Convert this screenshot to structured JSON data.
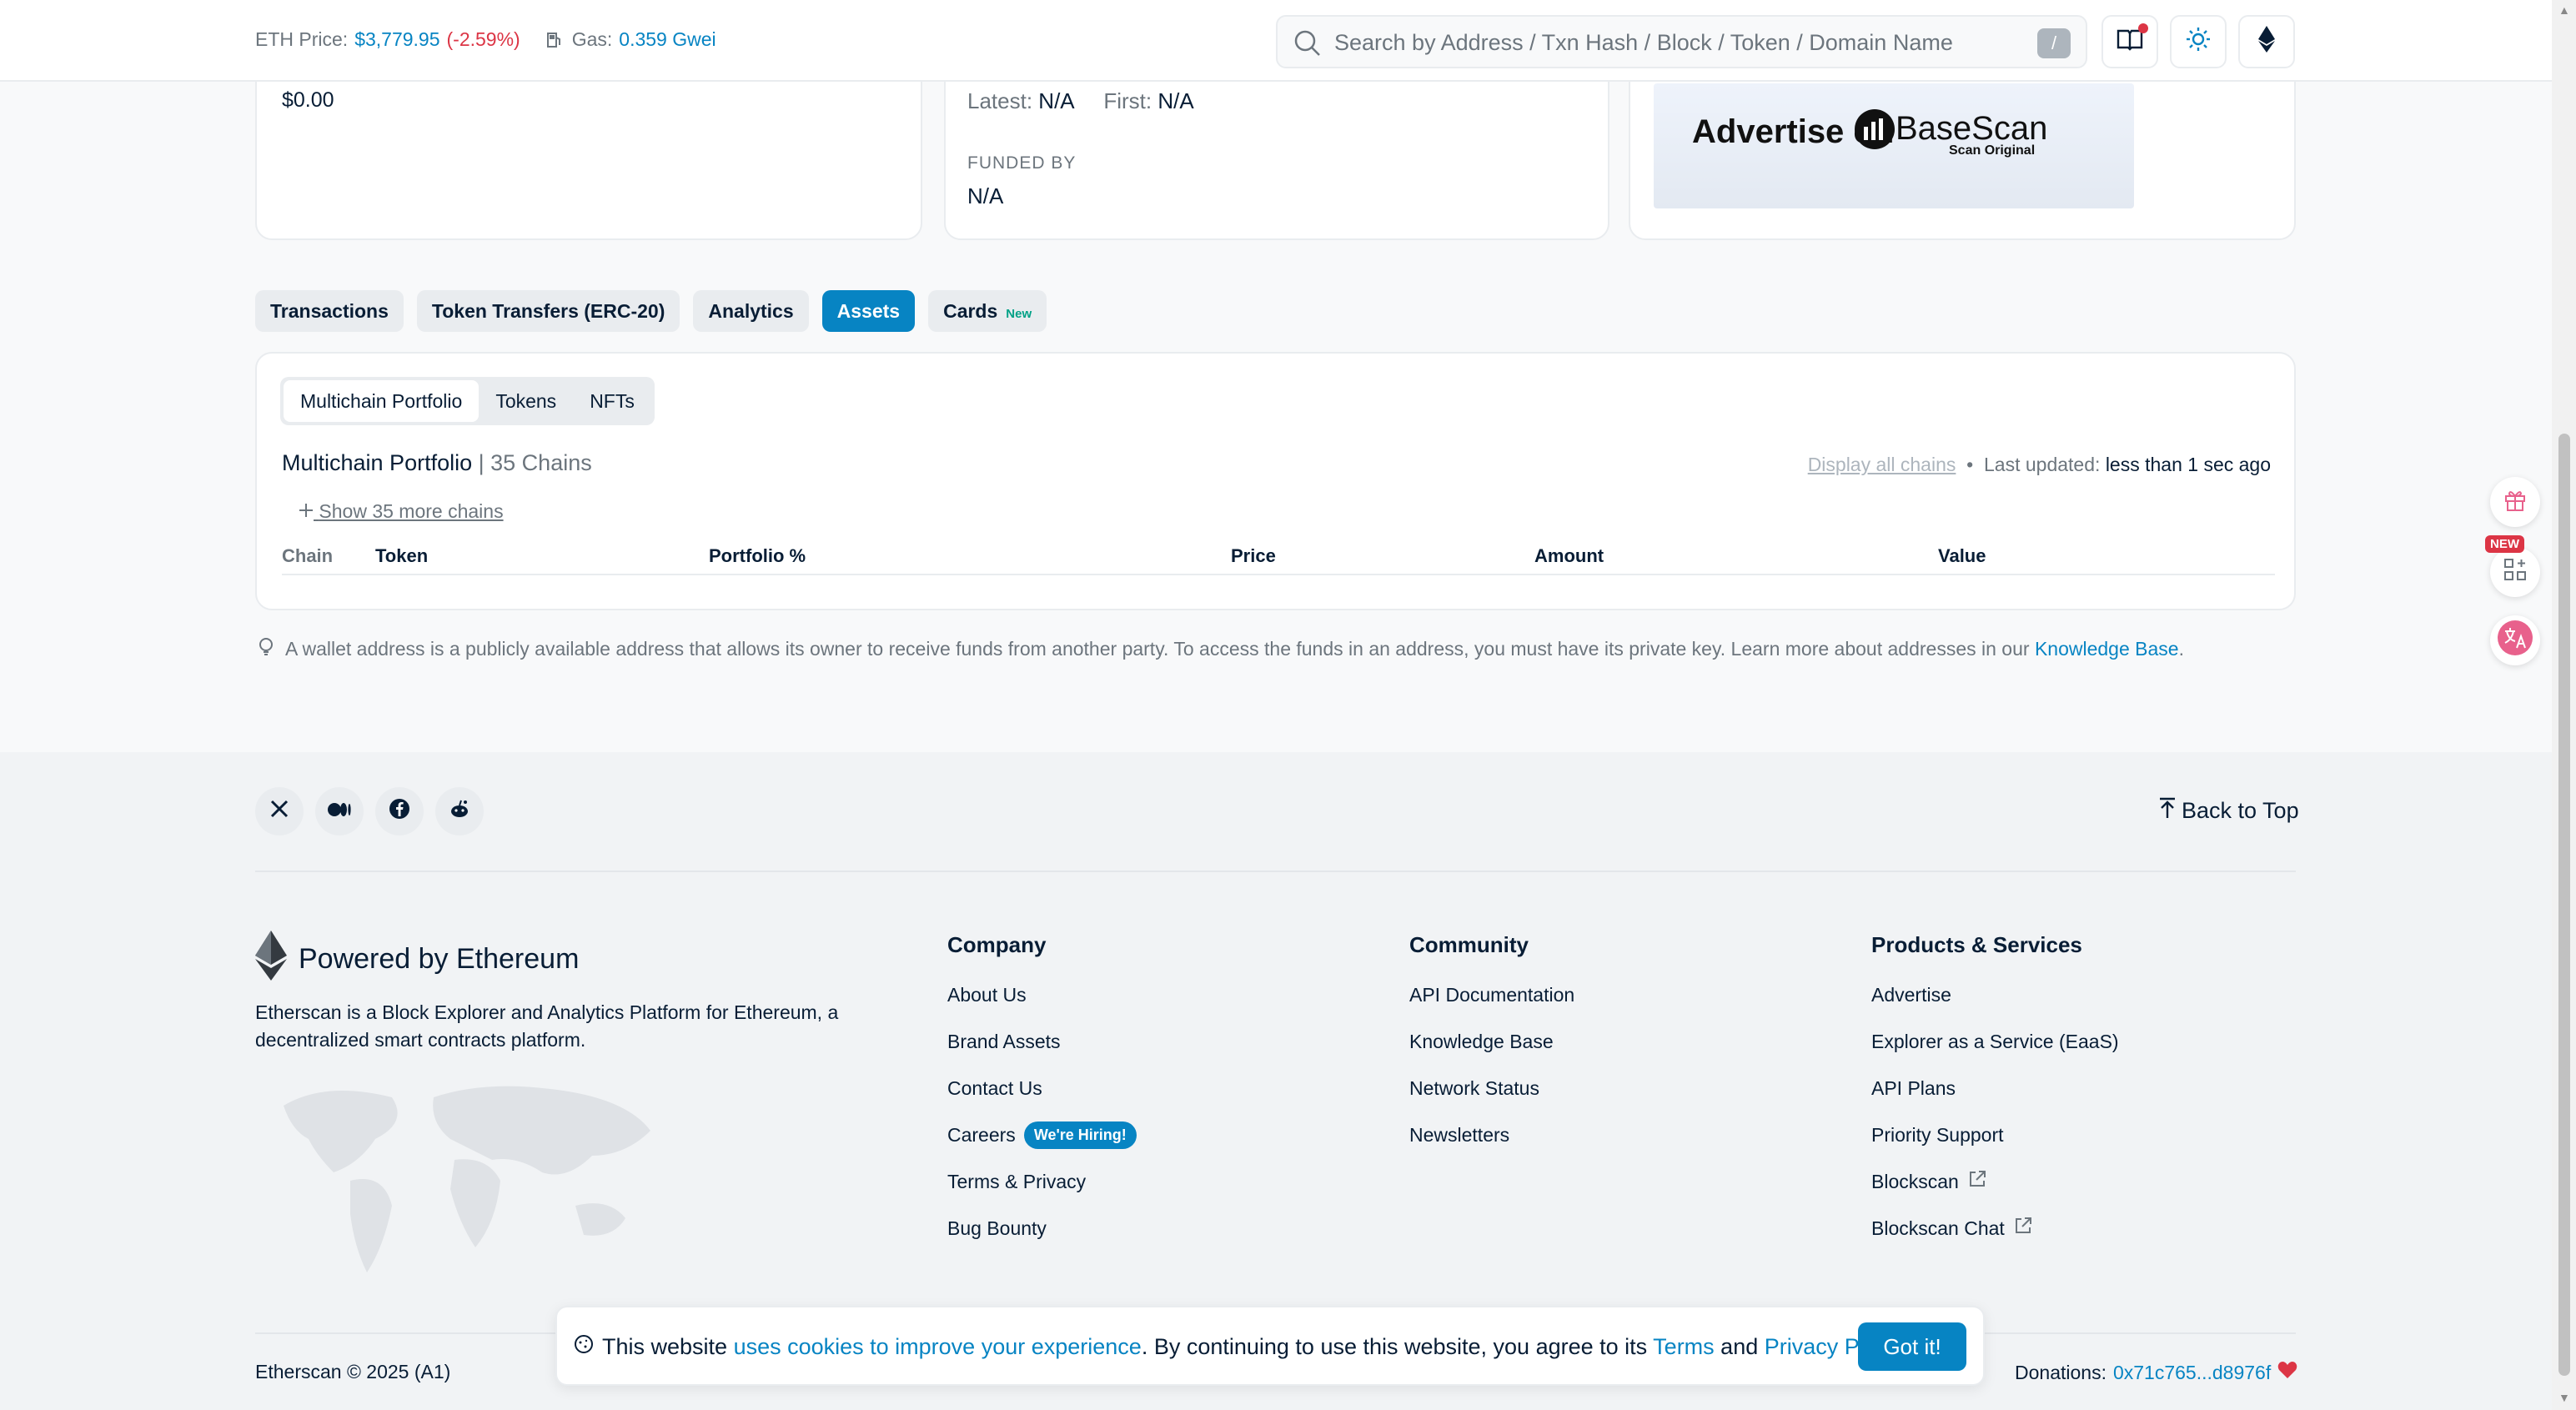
{
  "header": {
    "eth_price_label": "ETH Price:",
    "eth_price": "$3,779.95",
    "eth_change": "(-2.59%)",
    "gas_label": "Gas:",
    "gas_value": "0.359 Gwei",
    "search_placeholder": "Search by Address / Txn Hash / Block / Token / Domain Name",
    "search_shortcut": "/"
  },
  "overview": {
    "value": "$0.00",
    "latest_label": "Latest:",
    "latest_value": "N/A",
    "first_label": "First:",
    "first_value": "N/A",
    "funded_by_label": "FUNDED BY",
    "funded_by_value": "N/A",
    "ad_text": "Advertise on",
    "ad_brand": "BaseScan",
    "ad_brand_sub": "Scan Original"
  },
  "tabs": [
    {
      "label": "Transactions"
    },
    {
      "label": "Token Transfers (ERC-20)"
    },
    {
      "label": "Analytics"
    },
    {
      "label": "Assets"
    },
    {
      "label": "Cards",
      "badge": "New"
    }
  ],
  "assets": {
    "subtabs": [
      "Multichain Portfolio",
      "Tokens",
      "NFTs"
    ],
    "title": "Multichain Portfolio",
    "chains": "| 35 Chains",
    "display_all": "Display all chains",
    "bullet": "•",
    "last_updated_label": "Last updated:",
    "last_updated_value": "less than 1 sec ago",
    "show_more": "Show 35 more chains",
    "columns": [
      "Chain",
      "Token",
      "Portfolio %",
      "Price",
      "Amount",
      "Value"
    ]
  },
  "note": {
    "text": "A wallet address is a publicly available address that allows its owner to receive funds from another party. To access the funds in an address, you must have its private key. Learn more about addresses in our ",
    "link": "Knowledge Base",
    "end": "."
  },
  "footer": {
    "back_to_top": "Back to Top",
    "powered_by": "Powered by Ethereum",
    "description": "Etherscan is a Block Explorer and Analytics Platform for Ethereum, a decentralized smart contracts platform.",
    "company": {
      "heading": "Company",
      "links": [
        "About Us",
        "Brand Assets",
        "Contact Us",
        "Careers",
        "Terms & Privacy",
        "Bug Bounty"
      ],
      "careers_badge": "We're Hiring!"
    },
    "community": {
      "heading": "Community",
      "links": [
        "API Documentation",
        "Knowledge Base",
        "Network Status",
        "Newsletters"
      ]
    },
    "products": {
      "heading": "Products & Services",
      "links": [
        "Advertise",
        "Explorer as a Service (EaaS)",
        "API Plans",
        "Priority Support",
        "Blockscan",
        "Blockscan Chat"
      ]
    },
    "copyright": "Etherscan © 2025 (A1)",
    "donations_label": "Donations:",
    "donations_address": "0x71c765...d8976f"
  },
  "cookie": {
    "prefix": "This website ",
    "link1": "uses cookies to improve your experience",
    "middle": ". By continuing to use this website, you agree to its ",
    "link2": "Terms",
    "and": " and ",
    "link3": "Privacy Policy",
    "end": ".",
    "button": "Got it!"
  },
  "floating": {
    "new_tag": "NEW"
  },
  "colors": {
    "accent": "#0784c3",
    "negative": "#dc3545",
    "text": "#081d35",
    "muted": "#6c757d"
  }
}
